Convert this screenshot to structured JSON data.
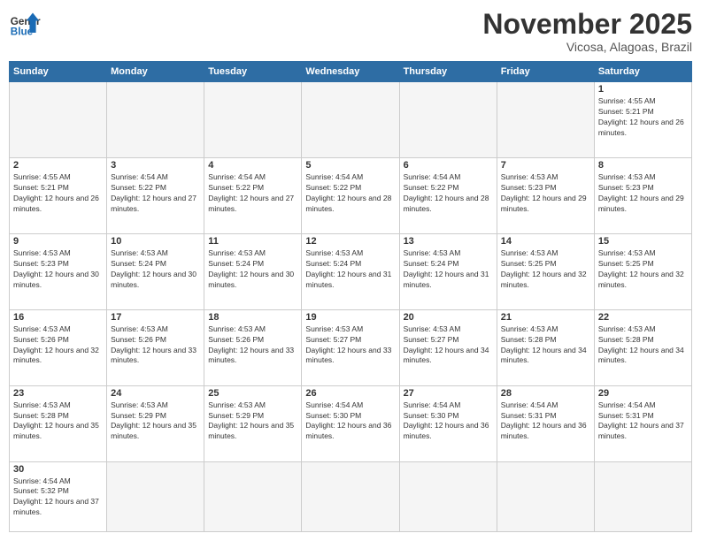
{
  "header": {
    "logo_general": "General",
    "logo_blue": "Blue",
    "month": "November 2025",
    "location": "Vicosa, Alagoas, Brazil"
  },
  "days_of_week": [
    "Sunday",
    "Monday",
    "Tuesday",
    "Wednesday",
    "Thursday",
    "Friday",
    "Saturday"
  ],
  "weeks": [
    [
      {
        "day": "",
        "info": ""
      },
      {
        "day": "",
        "info": ""
      },
      {
        "day": "",
        "info": ""
      },
      {
        "day": "",
        "info": ""
      },
      {
        "day": "",
        "info": ""
      },
      {
        "day": "",
        "info": ""
      },
      {
        "day": "1",
        "info": "Sunrise: 4:55 AM\nSunset: 5:21 PM\nDaylight: 12 hours and 26 minutes."
      }
    ],
    [
      {
        "day": "2",
        "info": "Sunrise: 4:55 AM\nSunset: 5:21 PM\nDaylight: 12 hours and 26 minutes."
      },
      {
        "day": "3",
        "info": "Sunrise: 4:54 AM\nSunset: 5:22 PM\nDaylight: 12 hours and 27 minutes."
      },
      {
        "day": "4",
        "info": "Sunrise: 4:54 AM\nSunset: 5:22 PM\nDaylight: 12 hours and 27 minutes."
      },
      {
        "day": "5",
        "info": "Sunrise: 4:54 AM\nSunset: 5:22 PM\nDaylight: 12 hours and 28 minutes."
      },
      {
        "day": "6",
        "info": "Sunrise: 4:54 AM\nSunset: 5:22 PM\nDaylight: 12 hours and 28 minutes."
      },
      {
        "day": "7",
        "info": "Sunrise: 4:53 AM\nSunset: 5:23 PM\nDaylight: 12 hours and 29 minutes."
      },
      {
        "day": "8",
        "info": "Sunrise: 4:53 AM\nSunset: 5:23 PM\nDaylight: 12 hours and 29 minutes."
      }
    ],
    [
      {
        "day": "9",
        "info": "Sunrise: 4:53 AM\nSunset: 5:23 PM\nDaylight: 12 hours and 30 minutes."
      },
      {
        "day": "10",
        "info": "Sunrise: 4:53 AM\nSunset: 5:24 PM\nDaylight: 12 hours and 30 minutes."
      },
      {
        "day": "11",
        "info": "Sunrise: 4:53 AM\nSunset: 5:24 PM\nDaylight: 12 hours and 30 minutes."
      },
      {
        "day": "12",
        "info": "Sunrise: 4:53 AM\nSunset: 5:24 PM\nDaylight: 12 hours and 31 minutes."
      },
      {
        "day": "13",
        "info": "Sunrise: 4:53 AM\nSunset: 5:24 PM\nDaylight: 12 hours and 31 minutes."
      },
      {
        "day": "14",
        "info": "Sunrise: 4:53 AM\nSunset: 5:25 PM\nDaylight: 12 hours and 32 minutes."
      },
      {
        "day": "15",
        "info": "Sunrise: 4:53 AM\nSunset: 5:25 PM\nDaylight: 12 hours and 32 minutes."
      }
    ],
    [
      {
        "day": "16",
        "info": "Sunrise: 4:53 AM\nSunset: 5:26 PM\nDaylight: 12 hours and 32 minutes."
      },
      {
        "day": "17",
        "info": "Sunrise: 4:53 AM\nSunset: 5:26 PM\nDaylight: 12 hours and 33 minutes."
      },
      {
        "day": "18",
        "info": "Sunrise: 4:53 AM\nSunset: 5:26 PM\nDaylight: 12 hours and 33 minutes."
      },
      {
        "day": "19",
        "info": "Sunrise: 4:53 AM\nSunset: 5:27 PM\nDaylight: 12 hours and 33 minutes."
      },
      {
        "day": "20",
        "info": "Sunrise: 4:53 AM\nSunset: 5:27 PM\nDaylight: 12 hours and 34 minutes."
      },
      {
        "day": "21",
        "info": "Sunrise: 4:53 AM\nSunset: 5:28 PM\nDaylight: 12 hours and 34 minutes."
      },
      {
        "day": "22",
        "info": "Sunrise: 4:53 AM\nSunset: 5:28 PM\nDaylight: 12 hours and 34 minutes."
      }
    ],
    [
      {
        "day": "23",
        "info": "Sunrise: 4:53 AM\nSunset: 5:28 PM\nDaylight: 12 hours and 35 minutes."
      },
      {
        "day": "24",
        "info": "Sunrise: 4:53 AM\nSunset: 5:29 PM\nDaylight: 12 hours and 35 minutes."
      },
      {
        "day": "25",
        "info": "Sunrise: 4:53 AM\nSunset: 5:29 PM\nDaylight: 12 hours and 35 minutes."
      },
      {
        "day": "26",
        "info": "Sunrise: 4:54 AM\nSunset: 5:30 PM\nDaylight: 12 hours and 36 minutes."
      },
      {
        "day": "27",
        "info": "Sunrise: 4:54 AM\nSunset: 5:30 PM\nDaylight: 12 hours and 36 minutes."
      },
      {
        "day": "28",
        "info": "Sunrise: 4:54 AM\nSunset: 5:31 PM\nDaylight: 12 hours and 36 minutes."
      },
      {
        "day": "29",
        "info": "Sunrise: 4:54 AM\nSunset: 5:31 PM\nDaylight: 12 hours and 37 minutes."
      }
    ],
    [
      {
        "day": "30",
        "info": "Sunrise: 4:54 AM\nSunset: 5:32 PM\nDaylight: 12 hours and 37 minutes."
      },
      {
        "day": "",
        "info": ""
      },
      {
        "day": "",
        "info": ""
      },
      {
        "day": "",
        "info": ""
      },
      {
        "day": "",
        "info": ""
      },
      {
        "day": "",
        "info": ""
      },
      {
        "day": "",
        "info": ""
      }
    ]
  ]
}
